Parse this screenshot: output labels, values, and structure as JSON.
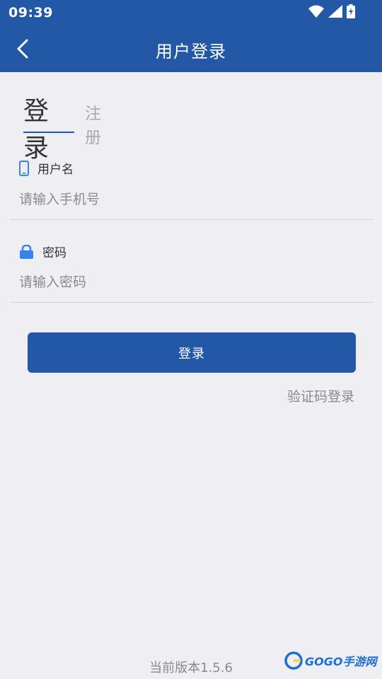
{
  "status_bar": {
    "time": "09:39"
  },
  "app_bar": {
    "title": "用户登录"
  },
  "tabs": {
    "login": "登录",
    "register": "注册"
  },
  "username": {
    "label": "用户名",
    "placeholder": "请输入手机号"
  },
  "password": {
    "label": "密码",
    "placeholder": "请输入密码"
  },
  "actions": {
    "login_button": "登录",
    "code_login": "验证码登录"
  },
  "footer": {
    "version": "当前版本1.5.6"
  },
  "watermark": {
    "text": "GOGO手游网"
  },
  "colors": {
    "primary": "#2358a6",
    "background": "#efeff3",
    "icon_blue": "#3a82f0"
  }
}
